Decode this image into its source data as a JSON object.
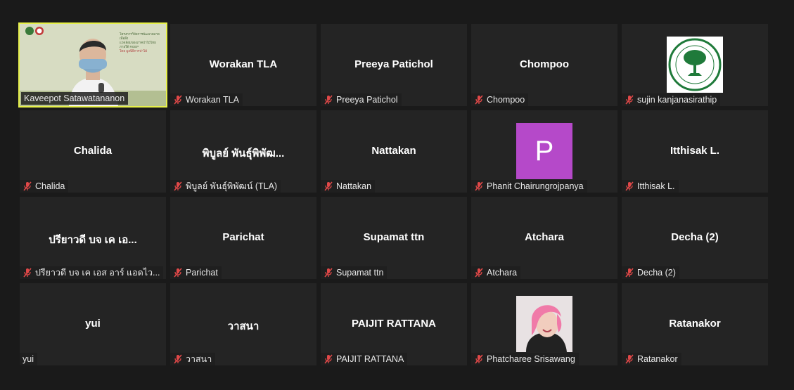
{
  "colors": {
    "active_border": "#e6f04a",
    "tile_bg": "#242424",
    "muted_icon": "#e04848",
    "avatar_p": "#b549c9"
  },
  "active_speaker": {
    "label": "Kaveepot Satawatananon",
    "slide_text": [
      "โครงการวิจัยการพัฒนาตลาดเพื่อสิ่ง",
      "แวดล้อมของภาคป่าไม้ไทย",
      "ภายใต้ RGEP",
      "โดย มูลนิธิการป่าไม้"
    ]
  },
  "tiles": [
    {
      "display": "Worakan TLA",
      "label": "Worakan TLA"
    },
    {
      "display": "Preeya Patichol",
      "label": "Preeya Patichol"
    },
    {
      "display": "Chompoo",
      "label": "Chompoo"
    },
    {
      "display": "",
      "label": "sujin kanjanasirathip",
      "logo_text": "THAI LATEX ASSOCIATION"
    },
    {
      "display": "Chalida",
      "label": "Chalida"
    },
    {
      "display": "พิบูลย์ พันธุ์พิพัฒ...",
      "label": "พิบูลย์ พันธุ์พิพัฒน์ (TLA)"
    },
    {
      "display": "Nattakan",
      "label": "Nattakan"
    },
    {
      "display": "",
      "label": "Phanit Chairungrojpanya",
      "avatar_letter": "P"
    },
    {
      "display": "Itthisak L.",
      "label": "Itthisak L."
    },
    {
      "display": "ปรียาวดี  บจ เค เอ...",
      "label": "ปรียาวดี  บจ เค เอส อาร์ แอดไว..."
    },
    {
      "display": "Parichat",
      "label": "Parichat"
    },
    {
      "display": "Supamat ttn",
      "label": "Supamat ttn"
    },
    {
      "display": "Atchara",
      "label": "Atchara"
    },
    {
      "display": "Decha (2)",
      "label": "Decha (2)"
    },
    {
      "display": "yui",
      "label": "yui"
    },
    {
      "display": "วาสนา",
      "label": "วาสนา"
    },
    {
      "display": "PAIJIT RATTANA",
      "label": "PAIJIT RATTANA"
    },
    {
      "display": "",
      "label": "Phatcharee Srisawang"
    },
    {
      "display": "Ratanakor",
      "label": "Ratanakor"
    }
  ]
}
